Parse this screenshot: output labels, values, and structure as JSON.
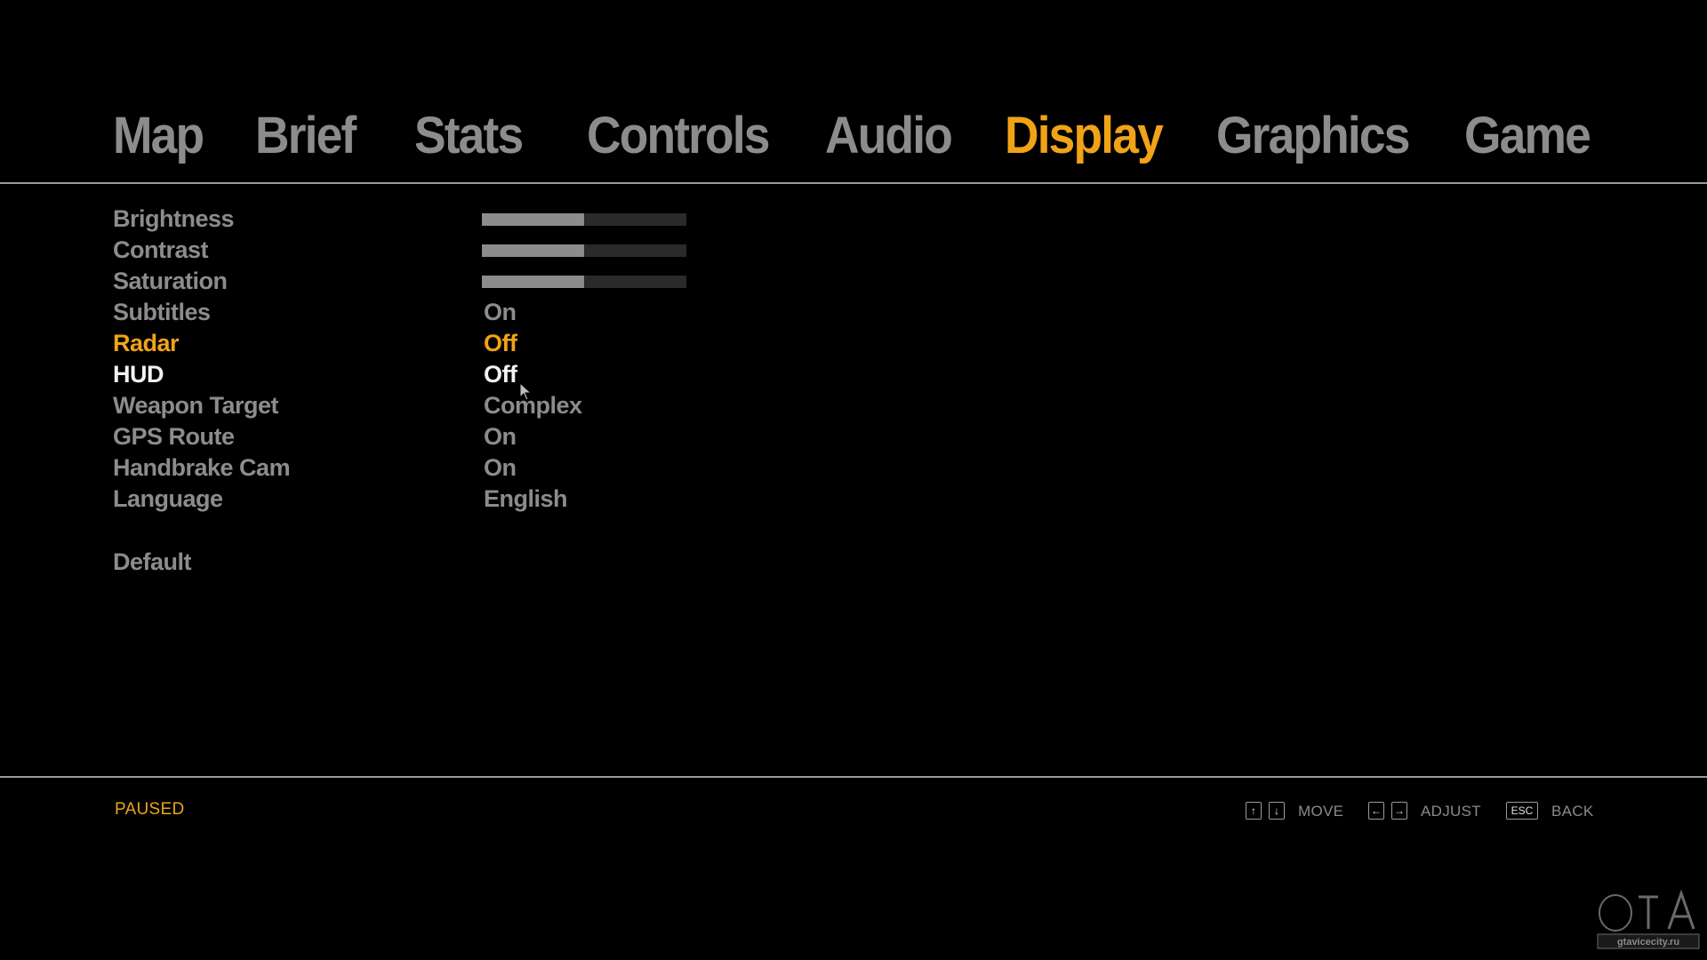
{
  "tabs": [
    {
      "label": "Map",
      "active": false
    },
    {
      "label": "Brief",
      "active": false
    },
    {
      "label": "Stats",
      "active": false
    },
    {
      "label": "Controls",
      "active": false
    },
    {
      "label": "Audio",
      "active": false
    },
    {
      "label": "Display",
      "active": true
    },
    {
      "label": "Graphics",
      "active": false
    },
    {
      "label": "Game",
      "active": false
    }
  ],
  "settings": [
    {
      "label": "Brightness",
      "type": "slider",
      "value": 0.5
    },
    {
      "label": "Contrast",
      "type": "slider",
      "value": 0.5
    },
    {
      "label": "Saturation",
      "type": "slider",
      "value": 0.5
    },
    {
      "label": "Subtitles",
      "type": "option",
      "value": "On"
    },
    {
      "label": "Radar",
      "type": "option",
      "value": "Off",
      "state": "selected"
    },
    {
      "label": "HUD",
      "type": "option",
      "value": "Off",
      "state": "hover"
    },
    {
      "label": "Weapon Target",
      "type": "option",
      "value": "Complex"
    },
    {
      "label": "GPS Route",
      "type": "option",
      "value": "On"
    },
    {
      "label": "Handbrake Cam",
      "type": "option",
      "value": "On"
    },
    {
      "label": "Language",
      "type": "option",
      "value": "English"
    }
  ],
  "default_label": "Default",
  "status": "PAUSED",
  "hints": {
    "move": {
      "keys": [
        "↑",
        "↓"
      ],
      "label": "MOVE"
    },
    "adjust": {
      "keys": [
        "←",
        "→"
      ],
      "label": "ADJUST"
    },
    "back": {
      "keys": [
        "ESC"
      ],
      "label": "BACK"
    }
  },
  "watermark": "gtavicecity.ru",
  "colors": {
    "accent": "#f1a317",
    "text": "#8c8c8c",
    "hover": "#f2f2f2",
    "background": "#000000"
  }
}
